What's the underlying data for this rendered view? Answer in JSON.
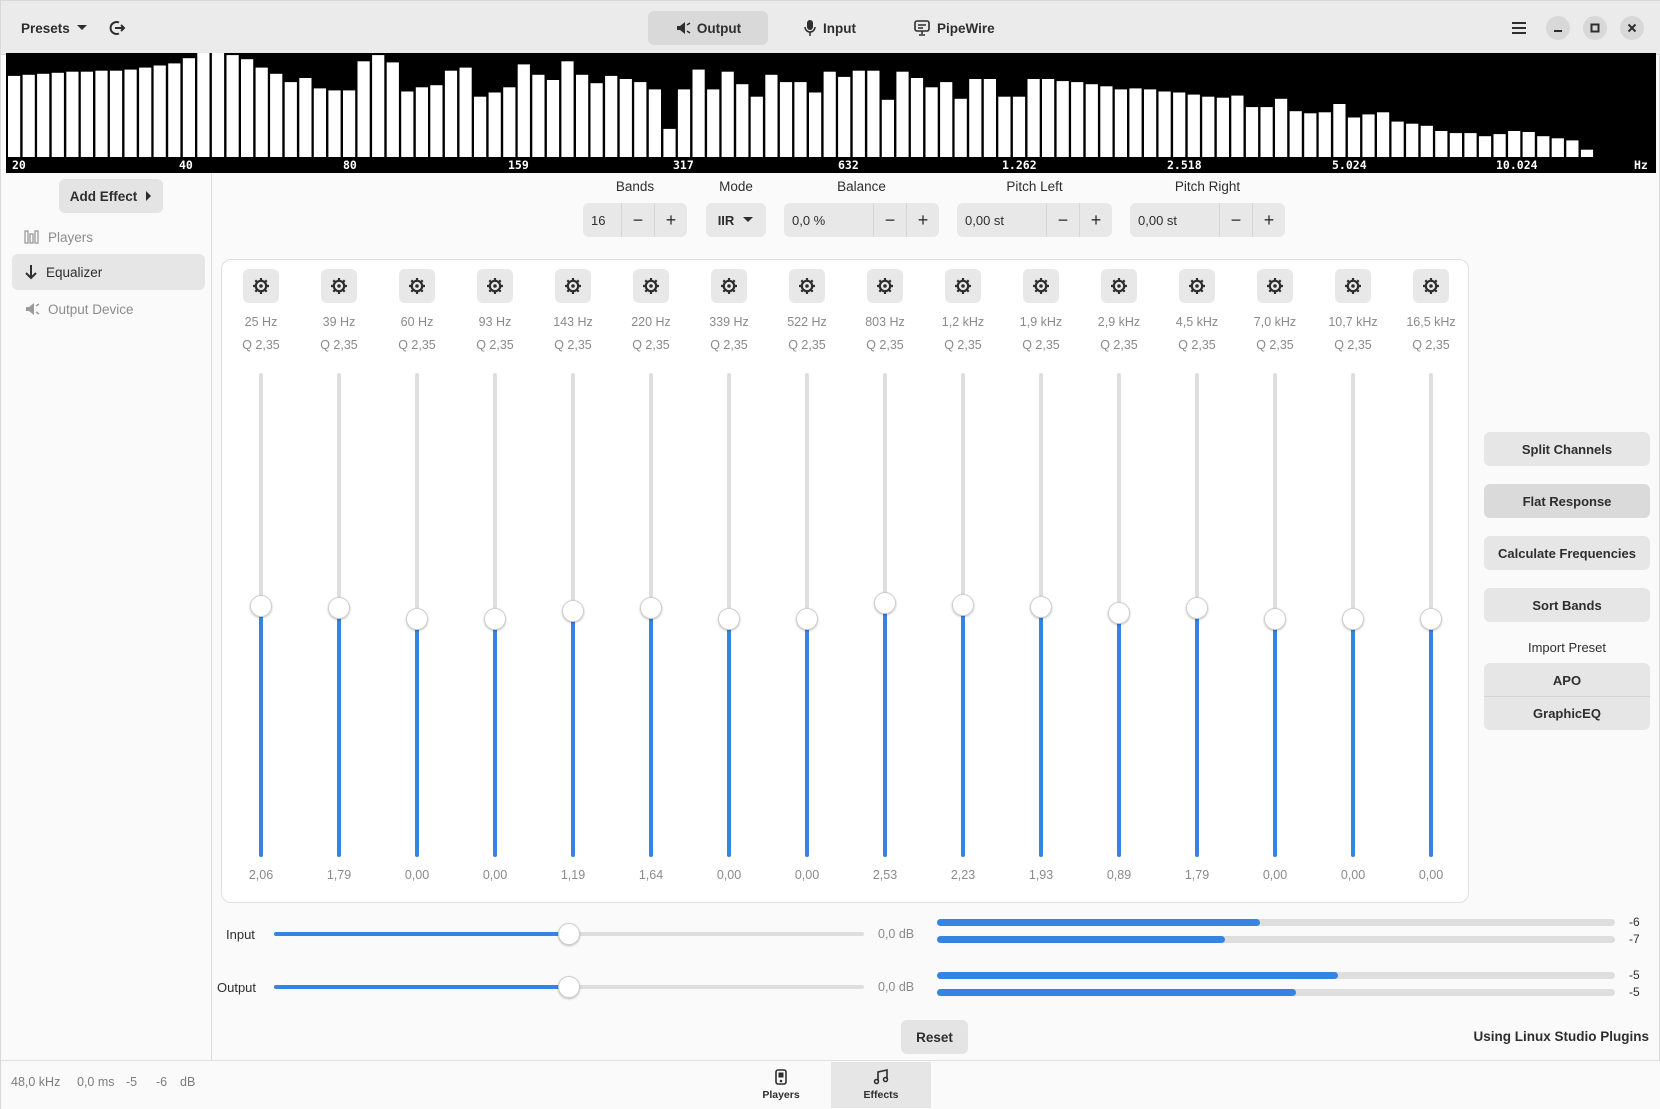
{
  "header": {
    "presets_label": "Presets",
    "tabs": [
      {
        "label": "Output",
        "icon": "speaker-icon",
        "active": true
      },
      {
        "label": "Input",
        "icon": "microphone-icon",
        "active": false
      },
      {
        "label": "PipeWire",
        "icon": "monitor-icon",
        "active": false
      }
    ]
  },
  "spectrum": {
    "frequency_labels": [
      "20",
      "40",
      "80",
      "159",
      "317",
      "632",
      "1.262",
      "2.518",
      "5.024",
      "10.024"
    ],
    "unit": "Hz",
    "bar_levels": [
      0.78,
      0.79,
      0.8,
      0.81,
      0.82,
      0.82,
      0.83,
      0.83,
      0.84,
      0.86,
      0.88,
      0.9,
      0.95,
      1.0,
      1.0,
      0.98,
      0.94,
      0.86,
      0.8,
      0.72,
      0.76,
      0.66,
      0.64,
      0.64,
      0.92,
      0.98,
      0.91,
      0.63,
      0.67,
      0.69,
      0.83,
      0.86,
      0.58,
      0.62,
      0.67,
      0.89,
      0.79,
      0.74,
      0.92,
      0.79,
      0.71,
      0.78,
      0.75,
      0.72,
      0.65,
      0.27,
      0.65,
      0.84,
      0.65,
      0.82,
      0.7,
      0.58,
      0.79,
      0.72,
      0.72,
      0.62,
      0.82,
      0.77,
      0.83,
      0.83,
      0.55,
      0.82,
      0.76,
      0.67,
      0.72,
      0.56,
      0.75,
      0.75,
      0.58,
      0.58,
      0.75,
      0.75,
      0.73,
      0.72,
      0.7,
      0.68,
      0.65,
      0.66,
      0.65,
      0.63,
      0.62,
      0.6,
      0.58,
      0.57,
      0.59,
      0.48,
      0.48,
      0.56,
      0.44,
      0.42,
      0.43,
      0.51,
      0.38,
      0.41,
      0.43,
      0.34,
      0.32,
      0.3,
      0.25,
      0.23,
      0.23,
      0.2,
      0.22,
      0.25,
      0.24,
      0.2,
      0.18,
      0.16,
      0.07,
      0.0
    ]
  },
  "sidebar": {
    "add_effect_label": "Add Effect",
    "items": [
      {
        "label": "Players",
        "icon": "players-icon",
        "state": "dim"
      },
      {
        "label": "Equalizer",
        "icon": "arrow-down-icon",
        "state": "selected"
      },
      {
        "label": "Output Device",
        "icon": "speaker-icon",
        "state": "dim"
      }
    ]
  },
  "controls": {
    "bands_label": "Bands",
    "bands_value": "16",
    "mode_label": "Mode",
    "mode_value": "IIR",
    "balance_label": "Balance",
    "balance_value": "0,0 %",
    "pitch_left_label": "Pitch Left",
    "pitch_left_value": "0,00 st",
    "pitch_right_label": "Pitch Right",
    "pitch_right_value": "0,00 st"
  },
  "bands": [
    {
      "freq": "25 Hz",
      "q": "Q 2,35",
      "gain": "2,06",
      "level": 0.518
    },
    {
      "freq": "39 Hz",
      "q": "Q 2,35",
      "gain": "1,79",
      "level": 0.514
    },
    {
      "freq": "60 Hz",
      "q": "Q 2,35",
      "gain": "0,00",
      "level": 0.492
    },
    {
      "freq": "93 Hz",
      "q": "Q 2,35",
      "gain": "0,00",
      "level": 0.492
    },
    {
      "freq": "143 Hz",
      "q": "Q 2,35",
      "gain": "1,19",
      "level": 0.508
    },
    {
      "freq": "220 Hz",
      "q": "Q 2,35",
      "gain": "1,64",
      "level": 0.514
    },
    {
      "freq": "339 Hz",
      "q": "Q 2,35",
      "gain": "0,00",
      "level": 0.492
    },
    {
      "freq": "522 Hz",
      "q": "Q 2,35",
      "gain": "0,00",
      "level": 0.492
    },
    {
      "freq": "803 Hz",
      "q": "Q 2,35",
      "gain": "2,53",
      "level": 0.524
    },
    {
      "freq": "1,2 kHz",
      "q": "Q 2,35",
      "gain": "2,23",
      "level": 0.52
    },
    {
      "freq": "1,9 kHz",
      "q": "Q 2,35",
      "gain": "1,93",
      "level": 0.516
    },
    {
      "freq": "2,9 kHz",
      "q": "Q 2,35",
      "gain": "0,89",
      "level": 0.504
    },
    {
      "freq": "4,5 kHz",
      "q": "Q 2,35",
      "gain": "1,79",
      "level": 0.514
    },
    {
      "freq": "7,0 kHz",
      "q": "Q 2,35",
      "gain": "0,00",
      "level": 0.492
    },
    {
      "freq": "10,7 kHz",
      "q": "Q 2,35",
      "gain": "0,00",
      "level": 0.492
    },
    {
      "freq": "16,5 kHz",
      "q": "Q 2,35",
      "gain": "0,00",
      "level": 0.492
    }
  ],
  "actions": {
    "split_channels": "Split Channels",
    "flat_response": "Flat Response",
    "calculate_frequencies": "Calculate Frequencies",
    "sort_bands": "Sort Bands",
    "import_preset_label": "Import Preset",
    "apo": "APO",
    "graphiceq": "GraphicEQ"
  },
  "io": {
    "input_label": "Input",
    "input_gain": "0,0 dB",
    "input_slider_level": 0.5,
    "input_levels": [
      {
        "fraction": 0.477,
        "value": "-6"
      },
      {
        "fraction": 0.425,
        "value": "-7"
      }
    ],
    "output_label": "Output",
    "output_gain": "0,0 dB",
    "output_slider_level": 0.5,
    "output_levels": [
      {
        "fraction": 0.592,
        "value": "-5"
      },
      {
        "fraction": 0.53,
        "value": "-5"
      }
    ]
  },
  "reset_label": "Reset",
  "plugins_note": "Using Linux Studio Plugins",
  "status": {
    "sample_rate": "48,0 kHz",
    "latency": "0,0 ms",
    "left_level": "-5",
    "right_level": "-6",
    "unit": "dB"
  },
  "view_switcher": [
    {
      "label": "Players",
      "icon": "media-player-icon",
      "active": false
    },
    {
      "label": "Effects",
      "icon": "music-note-icon",
      "active": true
    }
  ],
  "colors": {
    "accent": "#3584e4",
    "spectrum_bg": "#000000",
    "spectrum_bar": "#ffffff"
  }
}
